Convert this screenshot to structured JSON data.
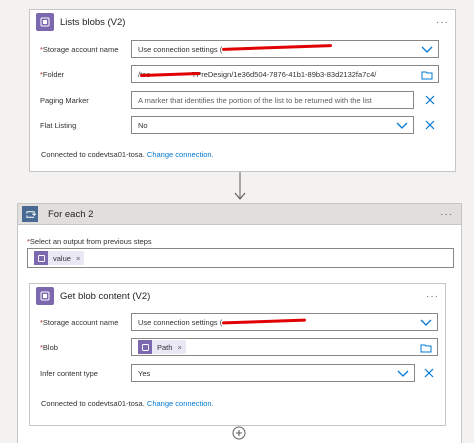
{
  "lists_blobs": {
    "title": "Lists blobs (V2)",
    "menu": "···",
    "storage_label": "Storage account name",
    "storage_value": "Use connection settings (",
    "folder_label": "Folder",
    "folder_value": "/tes                    TPreDesign/1e36d504-7876-41b1-89b3-83d2132fa7c4/",
    "paging_label": "Paging Marker",
    "paging_placeholder": "A marker that identifies the portion of the list to be returned with the list",
    "flat_label": "Flat Listing",
    "flat_value": "No",
    "connected_text": "Connected to codevtsa01-tosa.",
    "change_connection": "Change connection."
  },
  "for_each": {
    "title": "For each 2",
    "menu": "···",
    "select_label": "Select an output from previous steps",
    "token_value": "value"
  },
  "get_blob": {
    "title": "Get blob content (V2)",
    "menu": "···",
    "storage_label": "Storage account name",
    "storage_value": "Use connection settings (",
    "blob_label": "Blob",
    "blob_token": "Path",
    "infer_label": "Infer content type",
    "infer_value": "Yes",
    "connected_text": "Connected to codevtsa01-tosa.",
    "change_connection": "Change connection."
  },
  "icons": {
    "blob": "blob-storage-icon",
    "loop": "loop-icon",
    "chevron": "chevron-down-icon",
    "clear": "close-icon",
    "folder": "folder-icon",
    "add": "add-icon",
    "arrow": "arrow-down-icon"
  },
  "colors": {
    "blob": "#7b68ae",
    "loop": "#486991",
    "link": "#0078d4",
    "required": "#a4262c"
  }
}
